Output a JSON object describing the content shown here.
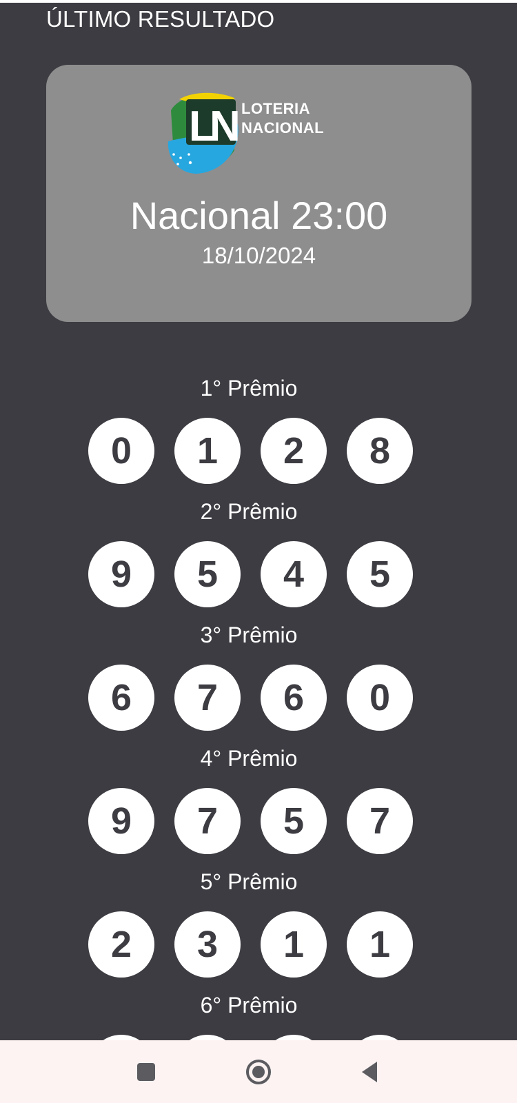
{
  "header": {
    "title": "ÚLTIMO RESULTADO"
  },
  "result": {
    "logo": {
      "name": "loteria-nacional-logo",
      "text_line1": "LOTERIA",
      "text_line2": "NACIONAL",
      "colors": [
        "#2e8b3d",
        "#f2d200",
        "#27a7e0",
        "#1d3b2a"
      ]
    },
    "draw_name": "Nacional 23:00",
    "draw_date": "18/10/2024"
  },
  "prizes": [
    {
      "label": "1° Prêmio",
      "digits": [
        "0",
        "1",
        "2",
        "8"
      ]
    },
    {
      "label": "2° Prêmio",
      "digits": [
        "9",
        "5",
        "4",
        "5"
      ]
    },
    {
      "label": "3° Prêmio",
      "digits": [
        "6",
        "7",
        "6",
        "0"
      ]
    },
    {
      "label": "4° Prêmio",
      "digits": [
        "9",
        "7",
        "5",
        "7"
      ]
    },
    {
      "label": "5° Prêmio",
      "digits": [
        "2",
        "3",
        "1",
        "1"
      ]
    },
    {
      "label": "6° Prêmio",
      "digits": [
        "",
        "",
        "",
        ""
      ]
    }
  ],
  "navigation": {
    "recents_icon": "square-icon",
    "home_icon": "circle-icon",
    "back_icon": "triangle-back-icon"
  },
  "colors": {
    "background": "#3d3c42",
    "card": "#8e8e8e",
    "ball": "#ffffff",
    "ball_text": "#3d3c42",
    "nav_bar": "#fdf3f2"
  }
}
